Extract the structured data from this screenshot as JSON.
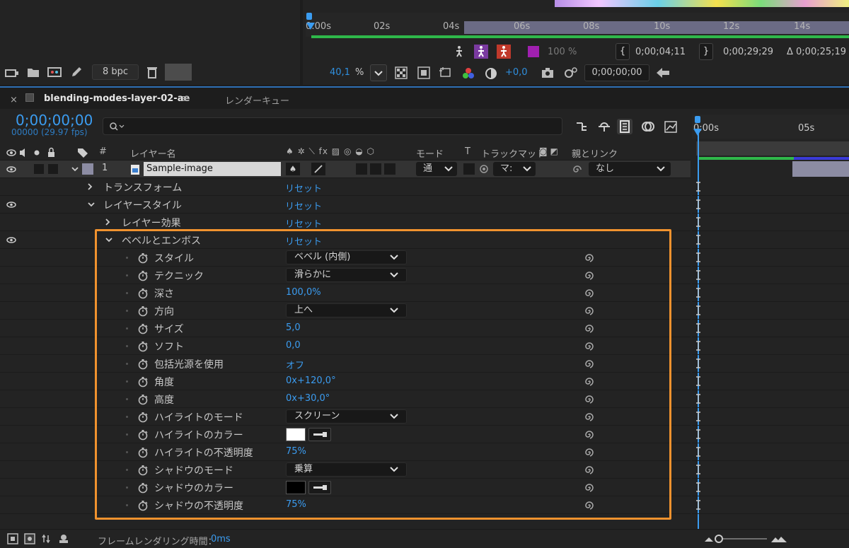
{
  "project_panel": {
    "bpc_label": "8 bpc"
  },
  "preview": {
    "ruler_ticks": [
      "0:00s",
      "02s",
      "04s",
      "06s",
      "08s",
      "10s",
      "12s",
      "14s"
    ],
    "percent": "100 %",
    "time_in": "0;00;04;11",
    "time_out": "0;00;29;29",
    "duration": "Δ 0;00;25;19",
    "zoom": "40,1",
    "zoom_unit": "%",
    "exposure": "+0,0",
    "timecode": "0;00;00;00"
  },
  "timeline": {
    "tab_name": "blending-modes-layer-02-ae",
    "render_queue_tab": "レンダーキュー",
    "current_time": "0;00;00;00",
    "frames": "00000 (29.97 fps)",
    "search_placeholder": "",
    "ruler_ticks": [
      "0:00s",
      "05s"
    ],
    "columns": {
      "num": "#",
      "layer_name": "レイヤー名",
      "mode": "モード",
      "t": "T",
      "track_matte": "トラックマット",
      "parent_link": "親とリンク"
    },
    "layer": {
      "number": "1",
      "name": "Sample-image",
      "mode": "通",
      "matte": "マ:",
      "parent": "なし"
    },
    "rows": [
      {
        "label": "トランスフォーム",
        "value": "リセット"
      },
      {
        "label": "レイヤースタイル",
        "value": "リセット"
      },
      {
        "label": "レイヤー効果",
        "value": "リセット"
      },
      {
        "label": "ベベルとエンボス",
        "value": "リセット"
      }
    ],
    "properties": [
      {
        "label": "スタイル",
        "type": "dropdown",
        "value": "ベベル (内側)"
      },
      {
        "label": "テクニック",
        "type": "dropdown",
        "value": "滑らかに"
      },
      {
        "label": "深さ",
        "type": "value",
        "value": "100,0%"
      },
      {
        "label": "方向",
        "type": "dropdown",
        "value": "上へ"
      },
      {
        "label": "サイズ",
        "type": "value",
        "value": "5,0"
      },
      {
        "label": "ソフト",
        "type": "value",
        "value": "0,0"
      },
      {
        "label": "包括光源を使用",
        "type": "value",
        "value": "オフ"
      },
      {
        "label": "角度",
        "type": "value",
        "value": "0x+120,0°"
      },
      {
        "label": "高度",
        "type": "value",
        "value": "0x+30,0°"
      },
      {
        "label": "ハイライトのモード",
        "type": "dropdown",
        "value": "スクリーン"
      },
      {
        "label": "ハイライトのカラー",
        "type": "color",
        "value": "#ffffff"
      },
      {
        "label": "ハイライトの不透明度",
        "type": "value",
        "value": "75%"
      },
      {
        "label": "シャドウのモード",
        "type": "dropdown",
        "value": "乗算"
      },
      {
        "label": "シャドウのカラー",
        "type": "color",
        "value": "#000000"
      },
      {
        "label": "シャドウの不透明度",
        "type": "value",
        "value": "75%"
      }
    ]
  },
  "footer": {
    "render_time_label": "フレームレンダリング時間：",
    "render_time_value": "0ms"
  },
  "colors": {
    "accent_blue": "#3b9cf0",
    "highlight_orange": "#f0922e",
    "bar_green": "#2fb84a"
  }
}
